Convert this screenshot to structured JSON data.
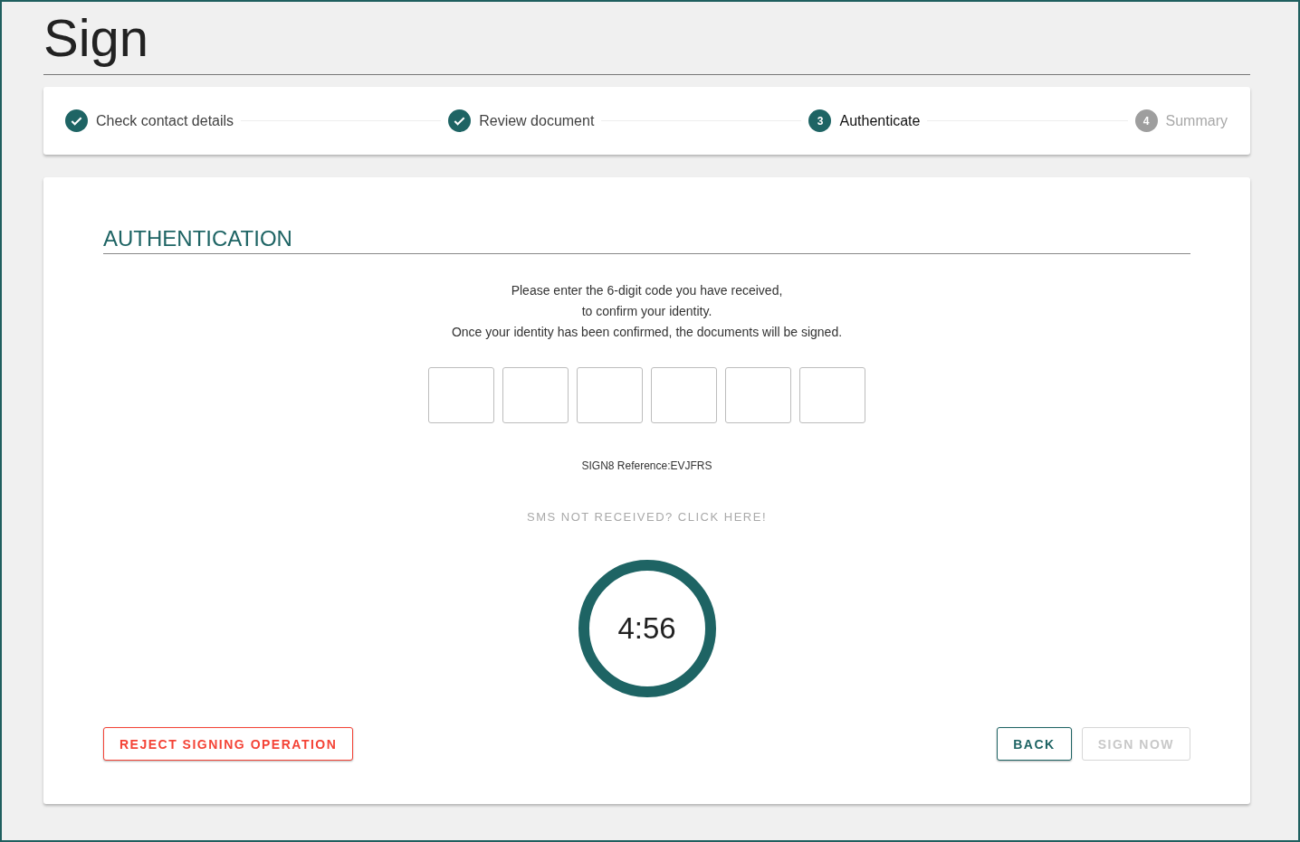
{
  "page_title": "Sign",
  "steps": [
    {
      "label": "Check contact details",
      "kind": "done",
      "selected": false
    },
    {
      "label": "Review document",
      "kind": "done",
      "selected": false
    },
    {
      "label": "Authenticate",
      "number": "3",
      "kind": "active",
      "selected": true
    },
    {
      "label": "Summary",
      "number": "4",
      "kind": "pending",
      "selected": false
    }
  ],
  "section_title": "AUTHENTICATION",
  "instructions": [
    "Please enter the 6-digit code you have received,",
    "to confirm your identity.",
    "Once your identity has been confirmed, the documents will be signed."
  ],
  "code_fields": [
    {
      "filled": false
    },
    {
      "filled": false
    },
    {
      "filled": false
    },
    {
      "filled": false
    },
    {
      "filled": false
    },
    {
      "filled": false
    }
  ],
  "reference": "SIGN8 Reference:EVJFRS",
  "resend_link": {
    "label": "SMS NOT RECEIVED? CLICK HERE!",
    "disabled": true
  },
  "timer": {
    "reading": "4:56",
    "level": 1
  },
  "buttons": [
    {
      "label": "REJECT SIGNING OPERATION",
      "kind": "danger",
      "disabled": false
    },
    {
      "label": "BACK",
      "kind": "primary",
      "disabled": false
    },
    {
      "label": "SIGN NOW",
      "kind": "primary",
      "disabled": true
    }
  ]
}
